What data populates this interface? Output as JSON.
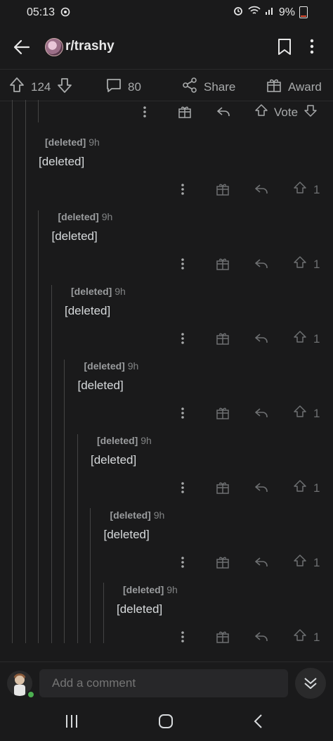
{
  "status": {
    "time": "05:13",
    "battery": "9%"
  },
  "header": {
    "subreddit": "r/trashy"
  },
  "post_actions": {
    "upvotes": "124",
    "comments": "80",
    "share": "Share",
    "award": "Award"
  },
  "top_actions": {
    "vote": "Vote"
  },
  "comments": [
    {
      "author": "[deleted]",
      "age": "9h",
      "body": "[deleted]",
      "score": "1"
    },
    {
      "author": "[deleted]",
      "age": "9h",
      "body": "[deleted]",
      "score": "1"
    },
    {
      "author": "[deleted]",
      "age": "9h",
      "body": "[deleted]",
      "score": "1"
    },
    {
      "author": "[deleted]",
      "age": "9h",
      "body": "[deleted]",
      "score": "1"
    },
    {
      "author": "[deleted]",
      "age": "9h",
      "body": "[deleted]",
      "score": "1"
    },
    {
      "author": "[deleted]",
      "age": "9h",
      "body": "[deleted]",
      "score": "1"
    },
    {
      "author": "[deleted]",
      "age": "9h",
      "body": "[deleted]",
      "score": "1"
    }
  ],
  "compose": {
    "placeholder": "Add a comment"
  },
  "icons": {
    "back": "arrow-left-icon",
    "bookmark": "bookmark-icon",
    "more": "more-vertical-icon",
    "upvote": "arrow-up-icon",
    "downvote": "arrow-down-icon",
    "comment": "comment-icon",
    "share": "share-icon",
    "award": "gift-icon",
    "reply": "reply-icon",
    "collapse": "chevrons-down-icon"
  },
  "colors": {
    "background": "#1a1a1b",
    "text": "#d7dadc",
    "muted": "#818384",
    "online": "#4caf50"
  }
}
